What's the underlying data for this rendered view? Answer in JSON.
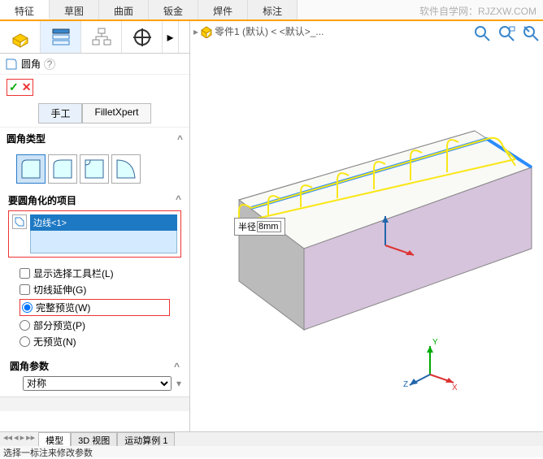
{
  "menu": {
    "items": [
      "特征",
      "草图",
      "曲面",
      "钣金",
      "焊件",
      "标注"
    ],
    "active": 0
  },
  "watermark": "软件自学网：RJZXW.COM",
  "feature": {
    "name": "圆角"
  },
  "confirm": {
    "ok": "✓",
    "cancel": "✕"
  },
  "modes": {
    "manual": "手工",
    "xpert": "FilletXpert"
  },
  "sections": {
    "type": "圆角类型",
    "items_header": "要圆角化的项目",
    "params": "圆角参数"
  },
  "selection": {
    "item1": "边线<1>"
  },
  "options": {
    "show_toolbar": "显示选择工具栏(L)",
    "tangent": "切线延伸(G)",
    "full_preview": "完整预览(W)",
    "partial_preview": "部分预览(P)",
    "no_preview": "无预览(N)"
  },
  "params": {
    "symmetric": "对称"
  },
  "breadcrumb": {
    "root": "零件1 (默认) < <默认>_..."
  },
  "dimension": {
    "label": "半径",
    "value": "8mm"
  },
  "footer_tabs": {
    "model": "模型",
    "view3d": "3D 视图",
    "motion": "运动算例 1"
  },
  "status": "选择一标注来修改参数",
  "triad": {
    "x": "X",
    "y": "Y",
    "z": "Z"
  }
}
